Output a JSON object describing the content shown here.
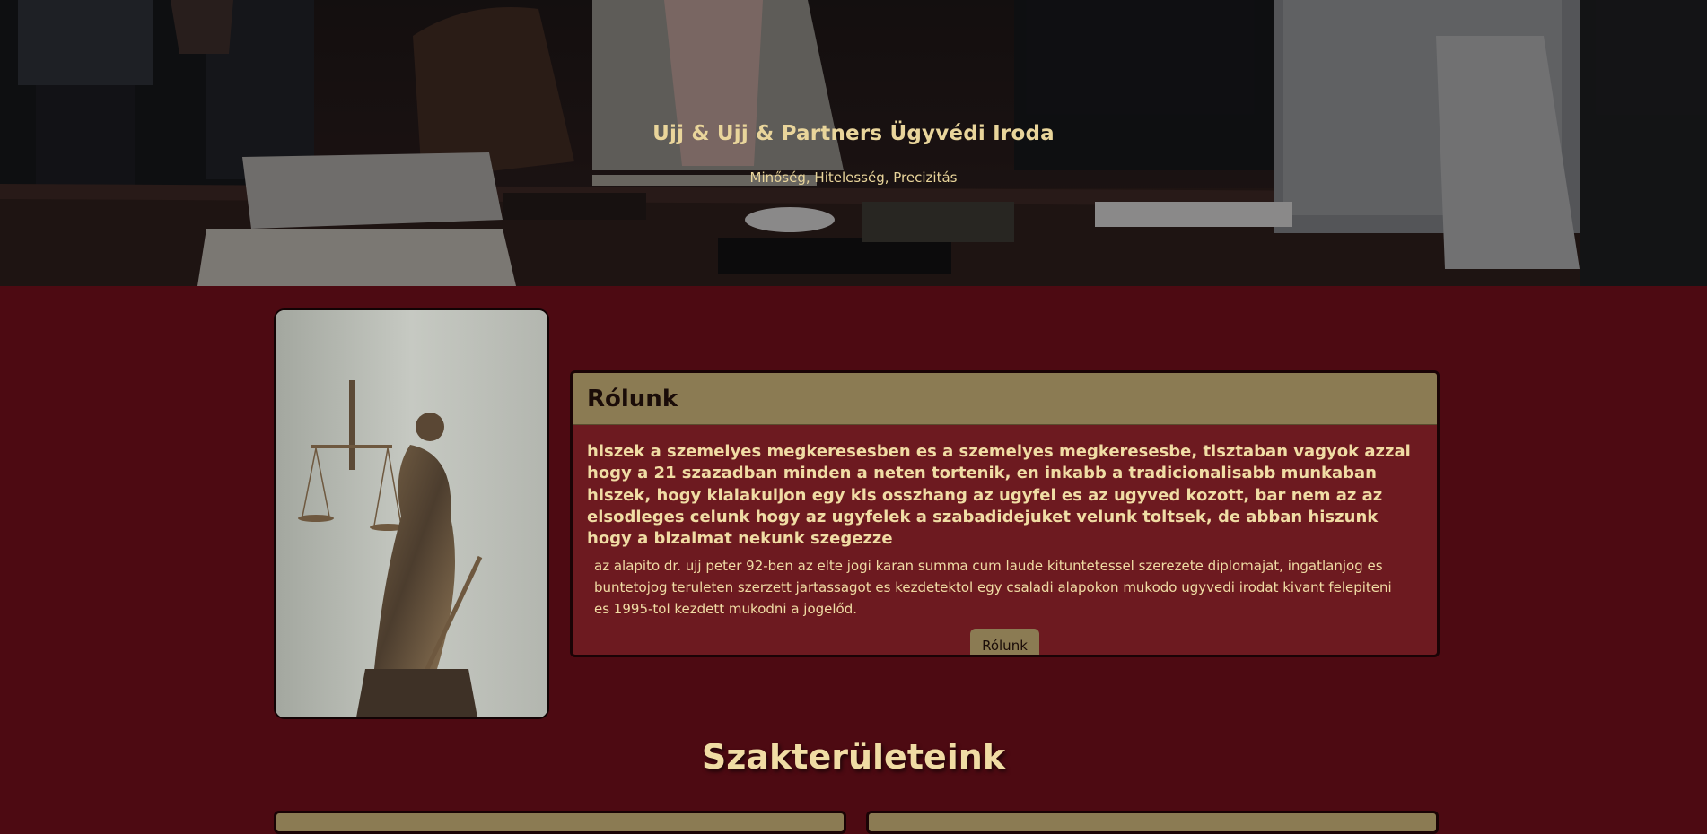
{
  "hero": {
    "title": "Ujj & Ujj & Partners Ügyvédi Iroda",
    "subtitle": "Minőség, Hitelesség, Precizitás"
  },
  "about": {
    "title": "Rólunk",
    "lead": "hiszek a szemelyes megkeresesben es a szemelyes megkeresesbe, tisztaban vagyok azzal hogy a 21 szazadban minden a neten tortenik, en inkabb a tradicionalisabb munkaban hiszek, hogy kialakuljon egy kis osszhang az ugyfel es az ugyved kozott, bar nem az az elsodleges celunk hogy az ugyfelek a szabadidejuket velunk toltsek, de abban hiszunk hogy a bizalmat nekunk szegezze",
    "body": "az alapito dr. ujj peter 92-ben az elte jogi karan summa cum laude kituntetessel szerezete diplomajat, ingatlanjog es buntetojog teruleten szerzett jartassagot es kezdetektol egy csaladi alapokon mukodo ugyvedi irodat kivant felepiteni es 1995-tol kezdett mukodni a jogelőd.",
    "button_label": "Rólunk"
  },
  "practice_areas": {
    "title": "Szakterületeink"
  },
  "colors": {
    "page_background": "#4d0a12",
    "card_background": "#6d1a20",
    "accent_gold": "#8b7b53",
    "text_cream": "#f0dca4"
  }
}
